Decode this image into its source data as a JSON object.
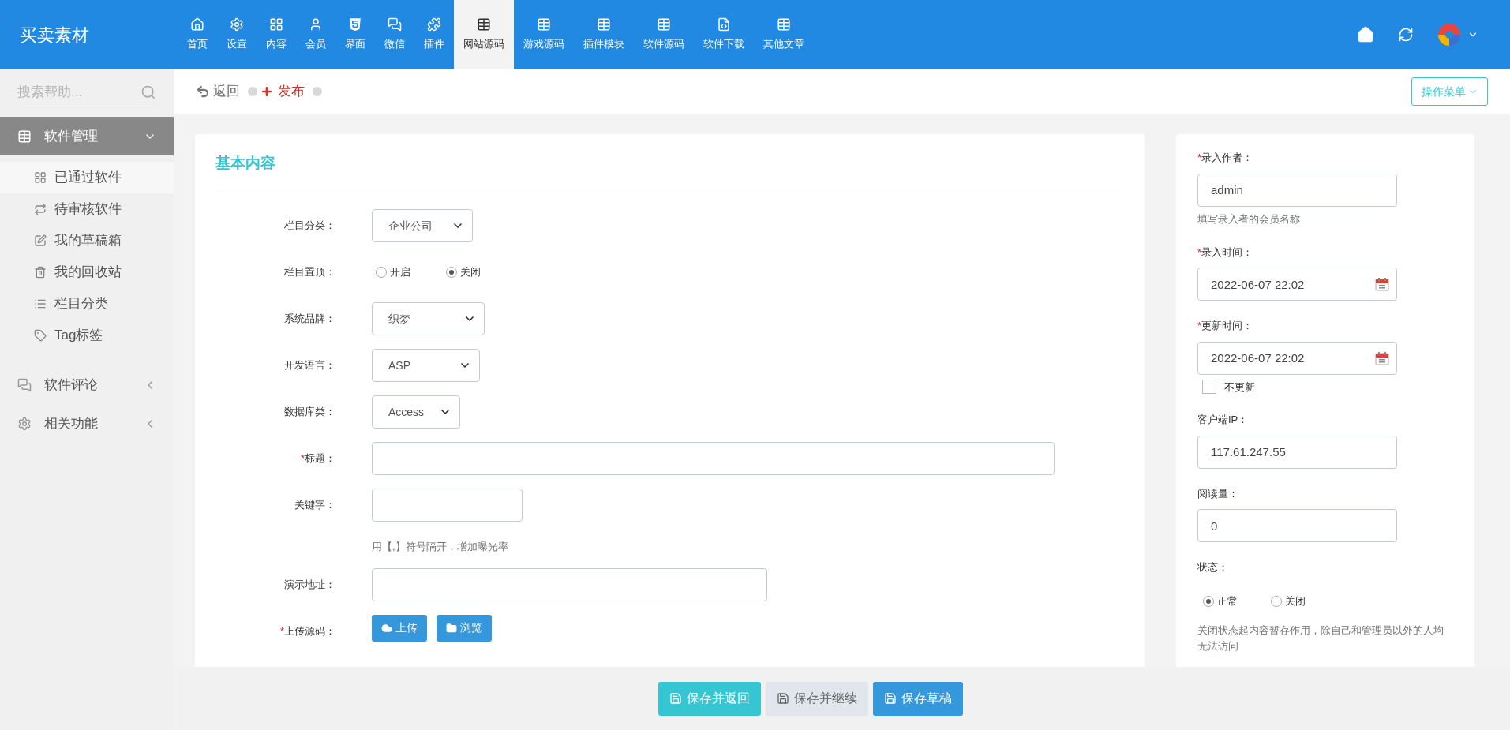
{
  "brand": "买卖素材",
  "nav": [
    {
      "label": "首页",
      "selected": false
    },
    {
      "label": "设置",
      "selected": false
    },
    {
      "label": "内容",
      "selected": false
    },
    {
      "label": "会员",
      "selected": false
    },
    {
      "label": "界面",
      "selected": false
    },
    {
      "label": "微信",
      "selected": false
    },
    {
      "label": "插件",
      "selected": false
    },
    {
      "label": "网站源码",
      "selected": true
    },
    {
      "label": "游戏源码",
      "selected": false
    },
    {
      "label": "插件模块",
      "selected": false
    },
    {
      "label": "软件源码",
      "selected": false
    },
    {
      "label": "软件下载",
      "selected": false
    },
    {
      "label": "其他文章",
      "selected": false
    }
  ],
  "sidebar": {
    "search_placeholder": "搜索帮助...",
    "groups": [
      {
        "label": "软件管理",
        "expanded": true,
        "children": [
          {
            "label": "已通过软件",
            "selected": true
          },
          {
            "label": "待审核软件",
            "selected": false
          },
          {
            "label": "我的草稿箱",
            "selected": false
          },
          {
            "label": "我的回收站",
            "selected": false
          },
          {
            "label": "栏目分类",
            "selected": false
          },
          {
            "label": "Tag标签",
            "selected": false
          }
        ]
      },
      {
        "label": "软件评论",
        "expanded": false
      },
      {
        "label": "相关功能",
        "expanded": false
      }
    ]
  },
  "toolbar": {
    "back": "返回",
    "publish": "发布",
    "menu": "操作菜单"
  },
  "form": {
    "title": "基本内容",
    "rows": [
      {
        "kind": "select",
        "label": "栏目分类：",
        "value": "企业公司"
      },
      {
        "kind": "radio",
        "label": "栏目置顶：",
        "options": [
          {
            "label": "开启",
            "selected": false
          },
          {
            "label": "关闭",
            "selected": true
          }
        ]
      },
      {
        "kind": "select",
        "label": "系统品牌：",
        "value": "织梦"
      },
      {
        "kind": "select",
        "label": "开发语言：",
        "value": "ASP"
      },
      {
        "kind": "select",
        "label": "数据库类：",
        "value": "Access"
      },
      {
        "kind": "text",
        "label": "标题：",
        "required_mark": "*"
      },
      {
        "kind": "text",
        "label": "关键字：",
        "hint": "用【,】符号隔开，增加曝光率"
      },
      {
        "kind": "text",
        "label": "演示地址："
      },
      {
        "kind": "upload",
        "label": "上传源码：",
        "required_mark": "*",
        "buttons": [
          "上传",
          "浏览"
        ]
      }
    ]
  },
  "side_panel": {
    "fields": [
      {
        "kind": "text",
        "label": "录入作者：",
        "required_mark": "*",
        "value": "admin",
        "hint": "填写录入者的会员名称"
      },
      {
        "kind": "date",
        "label": "录入时间：",
        "required_mark": "*",
        "value": "2022-06-07 22:02"
      },
      {
        "kind": "date",
        "label": "更新时间：",
        "required_mark": "*",
        "value": "2022-06-07 22:02",
        "checkbox": {
          "label": "不更新",
          "checked": false
        }
      },
      {
        "kind": "text",
        "label": "客户端IP：",
        "value": "117.61.247.55"
      },
      {
        "kind": "text",
        "label": "阅读量：",
        "value": "0"
      },
      {
        "kind": "radio",
        "label": "状态：",
        "options": [
          {
            "label": "正常",
            "selected": true
          },
          {
            "label": "关闭",
            "selected": false
          }
        ],
        "hint": "关闭状态起内容暂存作用，除自己和管理员以外的人均无法访问"
      }
    ]
  },
  "footer": [
    {
      "label": "保存并返回",
      "kind": "primary"
    },
    {
      "label": "保存并继续",
      "kind": "default"
    },
    {
      "label": "保存草稿",
      "kind": "blue"
    }
  ]
}
